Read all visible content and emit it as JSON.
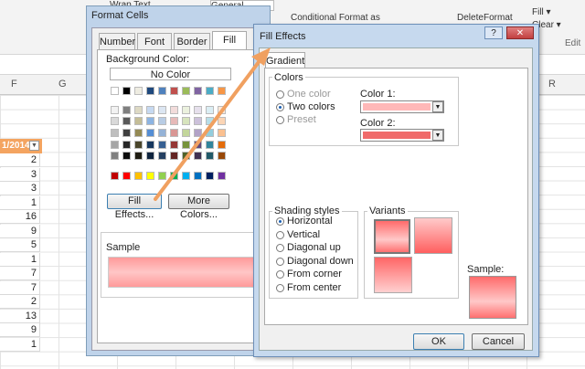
{
  "excel": {
    "ribbon": {
      "wrap_text": "Wrap Text",
      "number_format": "General",
      "conditional_formatting": "Conditional Format as",
      "delete": "Delete",
      "format": "Format",
      "fill": "Fill",
      "clear": "Clear",
      "editing_group": "Edit"
    },
    "columns": [
      "F",
      "G",
      "R"
    ],
    "filter_header": "1/2014",
    "cells": [
      "2",
      "3",
      "3",
      "1",
      "16",
      "9",
      "5",
      "1",
      "7",
      "7",
      "2",
      "13",
      "9",
      "1"
    ]
  },
  "format_cells": {
    "title": "Format Cells",
    "tabs": [
      "Number",
      "Font",
      "Border",
      "Fill"
    ],
    "background_color_label": "Background Color:",
    "no_color_label": "No Color",
    "fill_effects_button": "Fill Effects...",
    "more_colors_button": "More Colors...",
    "sample_label": "Sample",
    "palette": {
      "row1": [
        "#ffffff",
        "#000000",
        "#eeece1",
        "#1f497d",
        "#4f81bd",
        "#c0504d",
        "#9bbb59",
        "#8064a2",
        "#4bacc6",
        "#f79646"
      ],
      "row2": [
        "#f2f2f2",
        "#7f7f7f",
        "#ddd9c4",
        "#c6d9f1",
        "#dce6f2",
        "#f2dcdb",
        "#ebf1de",
        "#e6e0ec",
        "#dbeef4",
        "#fde9d9"
      ],
      "row3": [
        "#d9d9d9",
        "#595959",
        "#c4bd97",
        "#8db4e2",
        "#b8cce4",
        "#e6b9b8",
        "#d7e4bd",
        "#ccc1da",
        "#b7dee8",
        "#fbd5b5"
      ],
      "row4": [
        "#bfbfbf",
        "#404040",
        "#948a54",
        "#558ed5",
        "#95b3d7",
        "#d99694",
        "#c3d69b",
        "#b2a2c7",
        "#93cddd",
        "#fac090"
      ],
      "row5": [
        "#a6a6a6",
        "#262626",
        "#4a452a",
        "#17375e",
        "#376092",
        "#953735",
        "#77933c",
        "#604a7b",
        "#31859c",
        "#e46c0a"
      ],
      "row6": [
        "#808080",
        "#0d0d0d",
        "#1e1c11",
        "#0f243e",
        "#254061",
        "#632523",
        "#4f6228",
        "#403152",
        "#215968",
        "#984807"
      ],
      "standard": [
        "#c00000",
        "#ff0000",
        "#ffc000",
        "#ffff00",
        "#92d050",
        "#00b050",
        "#00b0f0",
        "#0070c0",
        "#002060",
        "#7030a0"
      ]
    }
  },
  "fill_effects": {
    "title": "Fill Effects",
    "help_button": "?",
    "close_button": "✕",
    "tab": "Gradient",
    "colors_group": "Colors",
    "options": {
      "one_color": "One color",
      "two_colors": "Two colors",
      "preset": "Preset"
    },
    "color1_label": "Color 1:",
    "color2_label": "Color 2:",
    "color1": "#ffb8b8",
    "color2": "#f06a6a",
    "shading_group": "Shading styles",
    "shading": [
      "Horizontal",
      "Vertical",
      "Diagonal up",
      "Diagonal down",
      "From corner",
      "From center"
    ],
    "variants_group": "Variants",
    "sample_label": "Sample:",
    "ok_button": "OK",
    "cancel_button": "Cancel"
  },
  "colors": {
    "accent_orange": "#f4a460",
    "arrow": "#f0a060"
  }
}
